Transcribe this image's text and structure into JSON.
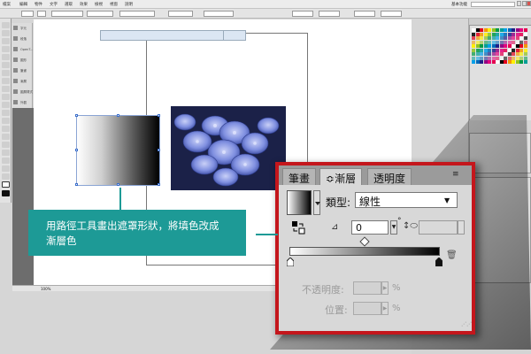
{
  "menubar": {
    "app_label": "檔案",
    "items": [
      "編輯",
      "物件",
      "文字",
      "選取",
      "效果",
      "檢視",
      "視窗",
      "說明"
    ],
    "workspace": "基本功能"
  },
  "gradient_panel": {
    "tabs": {
      "stroke": "筆畫",
      "gradient": "漸層",
      "transparency": "透明度"
    },
    "menu_icon": "≡",
    "type_label": "類型:",
    "type_value": "線性",
    "angle_value": "0",
    "degree_sign": "°",
    "opacity_label": "不透明度:",
    "location_label": "位置:",
    "percent": "%",
    "midpoint_fraction": 0.5,
    "stops": [
      {
        "color": "#ffffff",
        "location": 0
      },
      {
        "color": "#000000",
        "location": 1
      }
    ]
  },
  "callout": {
    "text": "用路徑工具畫出遮罩形狀，將填色改成漸層色"
  },
  "left_dock": {
    "items": [
      "字元",
      "段落",
      "OpenT...",
      "圖形",
      "筆畫",
      "漸層",
      "圖層樣式",
      "外觀"
    ]
  },
  "status": {
    "zoom": "100%"
  },
  "colors": {
    "accent_red": "#c4161c",
    "callout_teal": "#1d9a96",
    "panel_gray": "#d8d8d8"
  },
  "icons": {
    "reverse": "reverse-gradient-icon",
    "angle": "angle-icon",
    "aspect": "aspect-ratio-icon",
    "trash": "trash-icon"
  }
}
